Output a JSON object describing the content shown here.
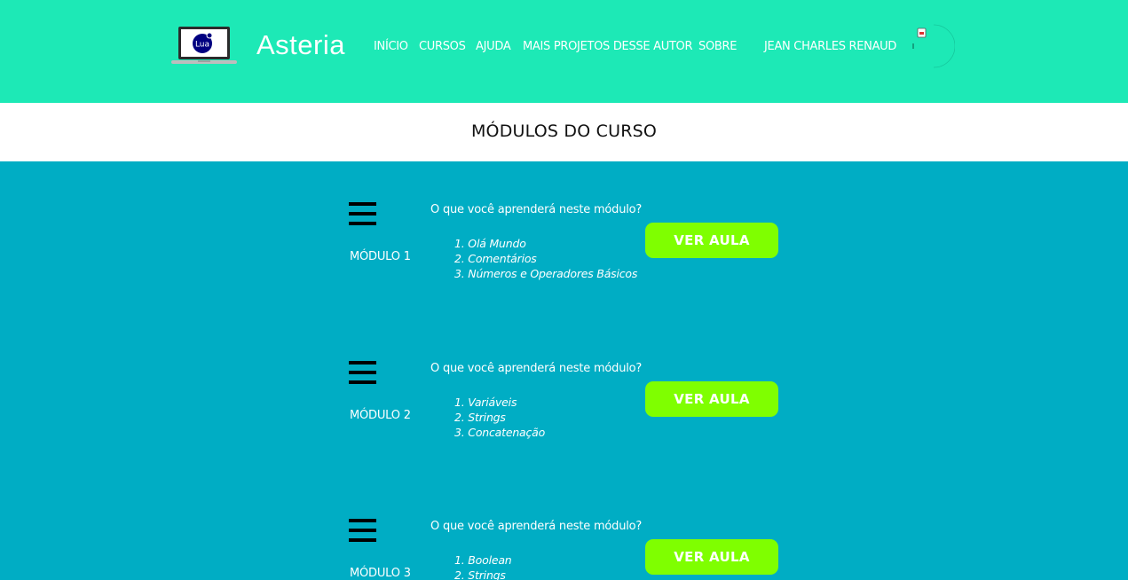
{
  "header": {
    "brand": "Asteria",
    "logo_text": "Lua",
    "nav": [
      "INÍCIO",
      "CURSOS",
      "AJUDA",
      "MAIS PROJETOS DESSE AUTOR",
      "SOBRE",
      "JEAN CHARLES RENAUD"
    ],
    "colors": {
      "background": "#1de9b6"
    }
  },
  "title_band": {
    "title": "MÓDULOS DO CURSO"
  },
  "modules": [
    {
      "label": "MÓDULO 1",
      "question": "O que você aprenderá neste módulo?",
      "topics": [
        "1. Olá Mundo",
        "2. Comentários",
        "3. Números e Operadores Básicos"
      ],
      "button": "VER AULA"
    },
    {
      "label": "MÓDULO 2",
      "question": "O que você aprenderá neste módulo?",
      "topics": [
        "1. Variáveis",
        "2. Strings",
        "3. Concatenação"
      ],
      "button": "VER AULA"
    },
    {
      "label": "MÓDULO 3",
      "question": "O que você aprenderá neste módulo?",
      "topics": [
        "1. Boolean",
        "2. Strings"
      ],
      "button": "VER AULA"
    }
  ],
  "colors": {
    "page_background": "#00adc4",
    "button": "#7fff00"
  }
}
